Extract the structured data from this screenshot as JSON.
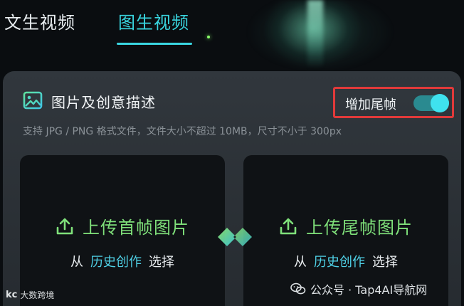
{
  "tabs": [
    {
      "label": "文生视频",
      "active": false
    },
    {
      "label": "图生视频",
      "active": true
    }
  ],
  "card": {
    "title": "图片及创意描述",
    "end_frame_toggle": {
      "label": "增加尾帧",
      "on": true
    },
    "hint": "支持 JPG / PNG 格式文件，文件大小不超过 10MB，尺寸不小于 300px"
  },
  "upload_first": {
    "label": "上传首帧图片",
    "from": "从",
    "history_link": "历史创作",
    "choose": "选择"
  },
  "upload_last": {
    "label": "上传尾帧图片",
    "from": "从",
    "history_link": "历史创作",
    "choose": "选择"
  },
  "watermarks": {
    "left_logo": "kc",
    "left_text": "大数跨境",
    "right_text": "公众号 · Tap4AI导航网"
  },
  "icons": [
    "image-icon",
    "upload-icon",
    "swap-icon",
    "wechat-icon"
  ],
  "colors": {
    "accent_cyan": "#39d6e0",
    "upload_green": "#7fe07a",
    "link_cyan": "#4fd1e6",
    "highlight_red": "#e13a3a"
  }
}
